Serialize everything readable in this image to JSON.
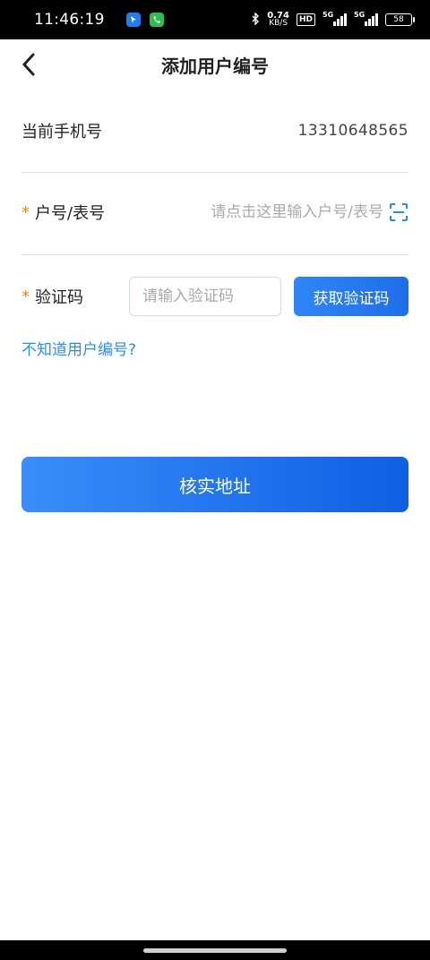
{
  "status_bar": {
    "time": "11:46:19",
    "app_badges": [
      "location-app-icon",
      "phone-app-icon"
    ],
    "net_speed_value": "0.74",
    "net_speed_unit": "KB/S",
    "hd_label": "HD",
    "signal_1_label": "5G",
    "signal_2_label": "5G",
    "battery_level": "58",
    "bluetooth_icon": "bluetooth-icon"
  },
  "nav": {
    "title": "添加用户编号",
    "back_icon": "chevron-left-icon"
  },
  "form": {
    "phone_label": "当前手机号",
    "phone_value": "13310648565",
    "required_mark": "*",
    "account_label": "户号/表号",
    "account_placeholder": "请点击这里输入户号/表号",
    "account_scan_icon": "scan-icon",
    "code_label": "验证码",
    "code_placeholder": "请输入验证码",
    "get_code_label": "获取验证码"
  },
  "help_link": "不知道用户编号?",
  "submit_label": "核实地址",
  "colors": {
    "primary": "#1e6ee8",
    "required": "#f08a2b",
    "link": "#2a8ee6",
    "divider": "#d6e2f2"
  }
}
